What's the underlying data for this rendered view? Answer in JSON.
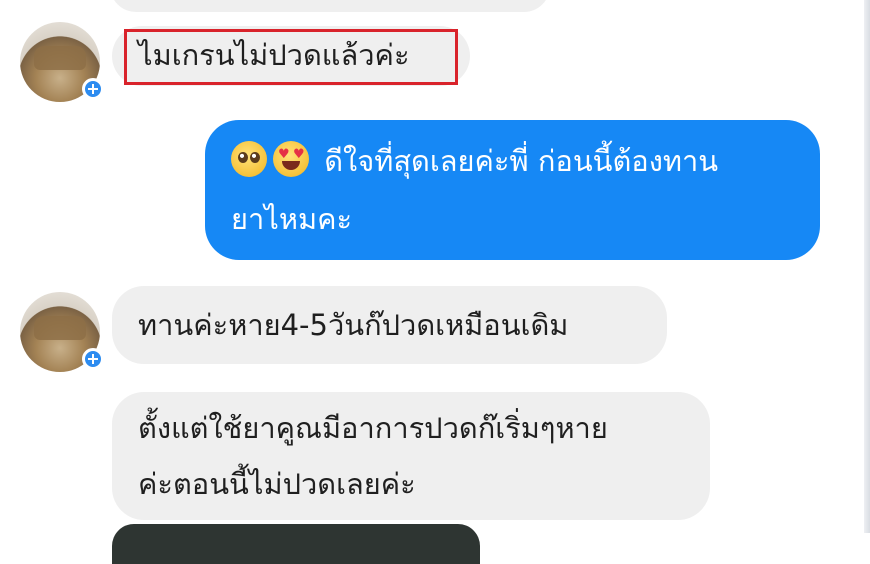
{
  "conversation": {
    "messages": [
      {
        "sender": "incoming",
        "text": "ไมเกรนไม่ปวดแล้วค่ะ"
      },
      {
        "sender": "outgoing",
        "emoji": [
          "pleading-face-emoji",
          "heart-eyes-emoji"
        ],
        "lines": [
          "ดีใจที่สุดเลยค่ะพี่ ก่อนนี้ต้องทาน",
          "ยาไหมคะ"
        ]
      },
      {
        "sender": "incoming",
        "text": "ทานค่ะหาย4-5วันก๊ปวดเหมือนเดิม"
      },
      {
        "sender": "incoming",
        "lines": [
          "ตั้งแต่ใช้ยาคูณมีอาการปวดก๊เริ่มๆหาย",
          "ค่ะตอนนี้ไม่ปวดเลยค่ะ"
        ]
      }
    ]
  },
  "colors": {
    "incoming_bubble": "#efefef",
    "outgoing_bubble": "#1688f5",
    "highlight_border": "#d9232b"
  }
}
